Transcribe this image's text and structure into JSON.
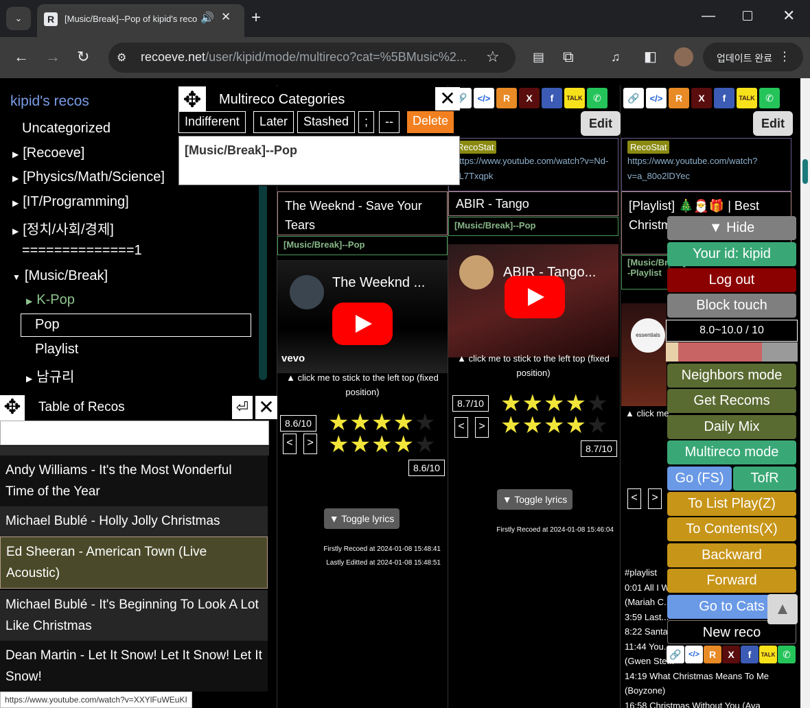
{
  "browser": {
    "tab_title": "[Music/Break]--Pop of kipid's reco",
    "url_domain": "recoeve.net",
    "url_path": "/user/kipid/mode/multireco?cat=%5BMusic%2...",
    "update_label": "업데이트 완료",
    "status_url": "https://www.youtube.com/watch?v=XXYlFuWEuKI"
  },
  "sidebar": {
    "title": "kipid's recos",
    "categories": [
      {
        "label": "Uncategorized"
      },
      {
        "label": "[Recoeve]"
      },
      {
        "label": "[Physics/Math/Science]"
      },
      {
        "label": "[IT/Programming]"
      },
      {
        "label": "[정치/사회/경제]"
      },
      {
        "label": "==============1"
      },
      {
        "label": "[Music/Break]"
      },
      {
        "label": "K-Pop"
      },
      {
        "label": "Pop"
      },
      {
        "label": "Playlist"
      },
      {
        "label": "남규리"
      }
    ]
  },
  "multireco_categories": {
    "title": "Multireco Categories",
    "buttons": [
      "Indifferent",
      "Later",
      "Stashed",
      ";",
      "--",
      "Delete"
    ],
    "value": "[Music/Break]--Pop"
  },
  "table_of_recos": {
    "title": "Table of Recos",
    "items": [
      "Andy Williams - It's the Most Wonderful Time of the Year",
      "Michael Bublé - Holly Jolly Christmas",
      "Ed Sheeran - American Town (Live Acoustic)",
      "Michael Bublé - It's Beginning To Look A Lot Like Christmas",
      "Dean Martin - Let It Snow! Let It Snow! Let It Snow!"
    ]
  },
  "recos": [
    {
      "url": "https://www.youtube.com/watch?v=Nd-kL7Txqpk",
      "title": "The Weeknd - Save Your Tears",
      "cat": "[Music/Break]--Pop",
      "video_title": "The Weeknd ...",
      "video_label": "vevo",
      "sticky": "▲ click me to stick to the left top (fixed position)",
      "score": "8.6/10",
      "score_value": 8.6,
      "toggle": "▼ Toggle lyrics",
      "first": "Firstly Recoed at 2024-01-08 15:48:41",
      "last": "Lastly Editted at 2024-01-08 15:48:51"
    },
    {
      "url": "https://www.youtube.com/watch?v=Nd-kL7Txqpk",
      "title": "ABIR - Tango",
      "cat": "[Music/Break]--Pop",
      "video_title": "ABIR - Tango...",
      "sticky": "▲ click me to stick to the left top (fixed position)",
      "score": "8.7/10",
      "score_value": 8.7,
      "toggle": "▼ Toggle lyrics",
      "first": "Firstly Recoed at 2024-01-08 15:46:04"
    },
    {
      "url": "https://www.youtube.com/watch?v=a_80o2lDYec",
      "title": "[Playlist] 🎄🎅🎁 | Best Christmas ... Time",
      "cat": "[Music/Break]--Playlist",
      "video_label": "essentials",
      "sticky": "▲ click me",
      "lyrics": [
        "#playlist",
        "0:01 All I Want...",
        "(Mariah C...",
        "3:59 Last...",
        "8:22 Santa...",
        "11:44 You...",
        "(Gwen Ste...",
        "14:19 What Christmas Means To Me",
        "(Boyzone)",
        "16:58 Christmas Without You (Ava"
      ]
    }
  ],
  "ui": {
    "edit": "Edit",
    "recostat": "RecoStat"
  },
  "nav_menu": {
    "hide": "▼ Hide",
    "your_id": "Your id: kipid",
    "logout": "Log out",
    "block_touch": "Block touch",
    "range": "8.0~10.0 / 10",
    "range_min": 8.0,
    "range_max": 10.0,
    "neighbors": "Neighbors mode",
    "get_recoms": "Get Recoms",
    "daily_mix": "Daily Mix",
    "multireco": "Multireco mode",
    "go_fs": "Go (FS)",
    "tofr": "TofR",
    "to_list_play": "To List Play(Z)",
    "to_contents": "To Contents(X)",
    "backward": "Backward",
    "forward": "Forward",
    "go_to_cats": "Go to Cats",
    "new_reco": "New reco"
  },
  "colors": {
    "accent_orange": "#f28020",
    "nav_green": "#3aa876",
    "star_yellow": "#f2e53a"
  }
}
